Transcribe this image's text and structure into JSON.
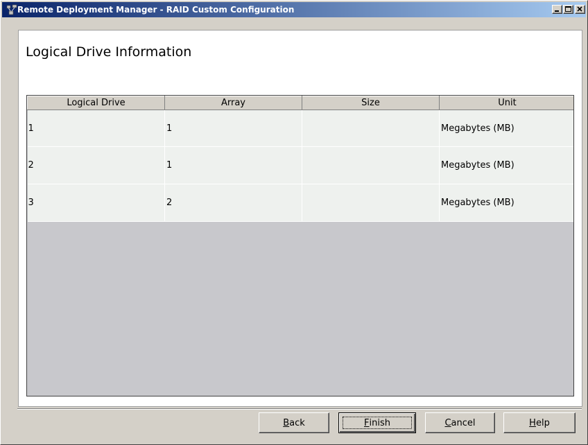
{
  "window": {
    "title": "Remote Deployment Manager - RAID Custom Configuration"
  },
  "titlebar_controls": {
    "minimize": "minimize",
    "maximize": "maximize",
    "close": "close"
  },
  "header": {
    "title": "Logical Drive Information"
  },
  "table": {
    "columns": [
      "Logical Drive",
      "Array",
      "Size",
      "Unit"
    ],
    "rows": [
      {
        "logical_drive": "1",
        "array": "1",
        "size": "",
        "unit": "Megabytes (MB)"
      },
      {
        "logical_drive": "2",
        "array": "1",
        "size": "",
        "unit": "Megabytes (MB)"
      },
      {
        "logical_drive": "3",
        "array": "2",
        "size": "",
        "unit": "Megabytes (MB)"
      }
    ]
  },
  "buttons": {
    "back": {
      "mnemonic": "B",
      "rest": "ack"
    },
    "finish": {
      "mnemonic": "F",
      "rest": "inish"
    },
    "cancel": {
      "mnemonic": "C",
      "rest": "ancel"
    },
    "help": {
      "mnemonic": "H",
      "rest": "elp"
    }
  },
  "colors": {
    "titlebar_start": "#0a246a",
    "titlebar_end": "#a6caf0",
    "window_bg": "#d4d0c8",
    "row_bg": "#eef1ee",
    "empty_area": "#c8c8cc"
  }
}
